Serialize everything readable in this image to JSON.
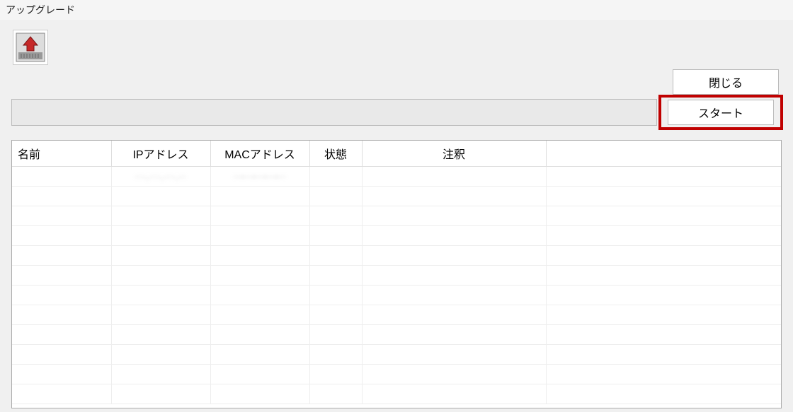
{
  "window": {
    "title": "アップグレード"
  },
  "toolbar": {
    "icon_name": "upgrade-icon"
  },
  "buttons": {
    "close_label": "閉じる",
    "start_label": "スタート"
  },
  "path_input": {
    "value": ""
  },
  "table": {
    "headers": {
      "name": "名前",
      "ip": "IPアドレス",
      "mac": "MACアドレス",
      "status": "状態",
      "note": "注釈"
    },
    "rows": [
      {
        "name": "",
        "ip": "···.···.···.··",
        "mac": "··-··-··-··-··",
        "status": "",
        "note": ""
      }
    ],
    "empty_row_count": 11
  },
  "highlight": {
    "target": "start-button",
    "color": "#c00000"
  }
}
